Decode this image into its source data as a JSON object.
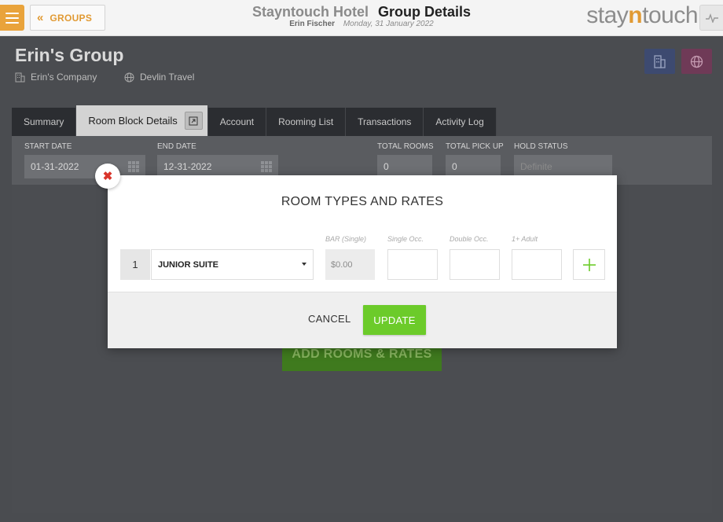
{
  "topbar": {
    "back_label": "GROUPS",
    "hotel_name": "Stayntouch Hotel",
    "page_title": "Group Details",
    "user_name": "Erin Fischer",
    "date": "Monday, 31 January 2022",
    "brand": {
      "pre": "stay",
      "mid": "n",
      "post": "touch"
    },
    "accent_color": "#e9a33b"
  },
  "group": {
    "name": "Erin's Group",
    "company": "Erin's Company",
    "travel_agent": "Devlin Travel"
  },
  "tabs": [
    {
      "label": "Summary"
    },
    {
      "label": "Room Block Details",
      "active": true
    },
    {
      "label": "Account"
    },
    {
      "label": "Rooming List"
    },
    {
      "label": "Transactions"
    },
    {
      "label": "Activity Log"
    }
  ],
  "block": {
    "start_date_label": "START DATE",
    "start_date": "01-31-2022",
    "end_date_label": "END DATE",
    "end_date": "12-31-2022",
    "total_rooms_label": "TOTAL ROOMS",
    "total_rooms": "0",
    "total_pickup_label": "TOTAL PICK UP",
    "total_pickup": "0",
    "hold_status_label": "HOLD STATUS",
    "hold_status": "Definite",
    "add_button": "ADD ROOMS & RATES"
  },
  "modal": {
    "title": "ROOM TYPES AND RATES",
    "columns": {
      "bar": "BAR (Single)",
      "single": "Single Occ.",
      "double": "Double Occ.",
      "extra_adult": "1+ Adult"
    },
    "rows": [
      {
        "number": "1",
        "room_type": "JUNIOR SUITE",
        "bar_rate": "$0.00",
        "single": "",
        "double": "",
        "extra_adult": ""
      }
    ],
    "cancel_label": "CANCEL",
    "update_label": "UPDATE",
    "update_color": "#6ccb2a"
  }
}
